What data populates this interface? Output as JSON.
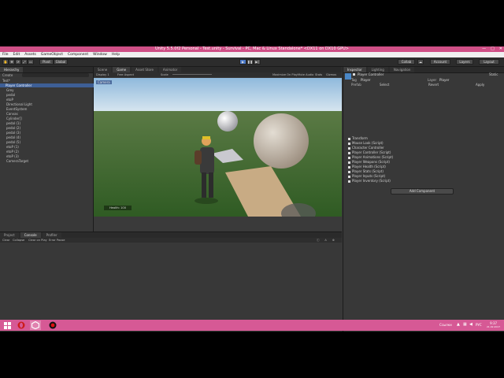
{
  "window": {
    "title": "Unity 5.5.0f2 Personal - Test.unity - Survival - PC, Mac & Linux Standalone* <DX11 on DX10 GPU>",
    "controls": [
      "—",
      "□",
      "✕"
    ]
  },
  "menu": [
    "File",
    "Edit",
    "Assets",
    "GameObject",
    "Component",
    "Window",
    "Help"
  ],
  "toolbar": {
    "pivot": "Pivot",
    "local": "Global",
    "collab": "Collab",
    "account": "Account",
    "layers": "Layers",
    "layout": "Layout"
  },
  "hierarchy": {
    "tab": "Hierarchy",
    "create": "Create",
    "items": [
      "Test*",
      "Player Controller",
      "Grey",
      "pedal",
      "etoP",
      "Directional Light",
      "EventSystem",
      "Canvas",
      "Cylinder[]",
      "pedal (1)",
      "pedal (2)",
      "pedal (3)",
      "pedal (4)",
      "pedal (5)",
      "etoP (1)",
      "etoP (2)",
      "etoP (3)",
      "CameraTarget"
    ]
  },
  "scene_tabs": [
    "Scene",
    "Game",
    "Asset Store",
    "Animator"
  ],
  "game_view": {
    "display": "Display 1",
    "aspect": "Free Aspect",
    "scale": "Scale",
    "options": [
      "Maximize On Play",
      "Mute Audio",
      "Stats",
      "Gizmos"
    ],
    "health": "Health: 100",
    "overlay_label": "Camera"
  },
  "bottom": {
    "tabs": [
      "Project",
      "Console",
      "Profiler"
    ],
    "buttons": [
      "Clear",
      "Collapse",
      "Clear on Play",
      "Error Pause"
    ]
  },
  "inspector": {
    "tabs": [
      "Inspector",
      "Lighting",
      "Navigation"
    ],
    "object_name": "Player Controller",
    "static": "Static",
    "tag": "Tag",
    "tag_value": "Player",
    "layer": "Layer",
    "layer_value": "Player",
    "prefab": "Prefab",
    "prefab_buttons": [
      "Select",
      "Revert",
      "Apply"
    ],
    "components": [
      "Transform",
      "Mouse Look (Script)",
      "Character Controller",
      "Player Controller (Script)",
      "Player Animations (Script)",
      "Player Weapons (Script)",
      "Player Health (Script)",
      "Player Stats (Script)",
      "Player Inputs (Script)",
      "Player Inventory (Script)"
    ],
    "add_component": "Add Component"
  },
  "taskbar": {
    "lang": "РУС",
    "time": "9:37",
    "date": "21.02.2017",
    "tray": "Ссылки"
  },
  "colors": {
    "titlebar": "#cf4f86",
    "taskbar": "#d65995",
    "editor_bg": "#383838",
    "selection": "#3e5f96",
    "sky": "#9dc3e0",
    "grass": "#3e6a2c"
  }
}
